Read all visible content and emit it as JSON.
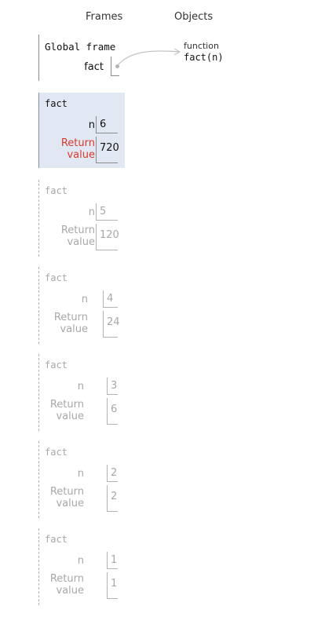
{
  "headers": {
    "frames": "Frames",
    "objects": "Objects"
  },
  "global_frame": {
    "title": "Global frame",
    "var": "fact"
  },
  "function_object": {
    "kind": "function",
    "signature": "fact(n)"
  },
  "return_label": [
    "Return",
    "value"
  ],
  "frames": [
    {
      "title": "fact",
      "n_label": "n",
      "n": "6",
      "ret": "720",
      "state": "active"
    },
    {
      "title": "fact",
      "n_label": "n",
      "n": "5",
      "ret": "120",
      "state": "done"
    },
    {
      "title": "fact",
      "n_label": "n",
      "n": "4",
      "ret": "24",
      "state": "done"
    },
    {
      "title": "fact",
      "n_label": "n",
      "n": "3",
      "ret": "6",
      "state": "done"
    },
    {
      "title": "fact",
      "n_label": "n",
      "n": "2",
      "ret": "2",
      "state": "done"
    },
    {
      "title": "fact",
      "n_label": "n",
      "n": "1",
      "ret": "1",
      "state": "done"
    }
  ],
  "colors": {
    "active_bg": "#e2e8f3",
    "return_highlight": "#d9392b",
    "faded_text": "#a8a8a8"
  }
}
